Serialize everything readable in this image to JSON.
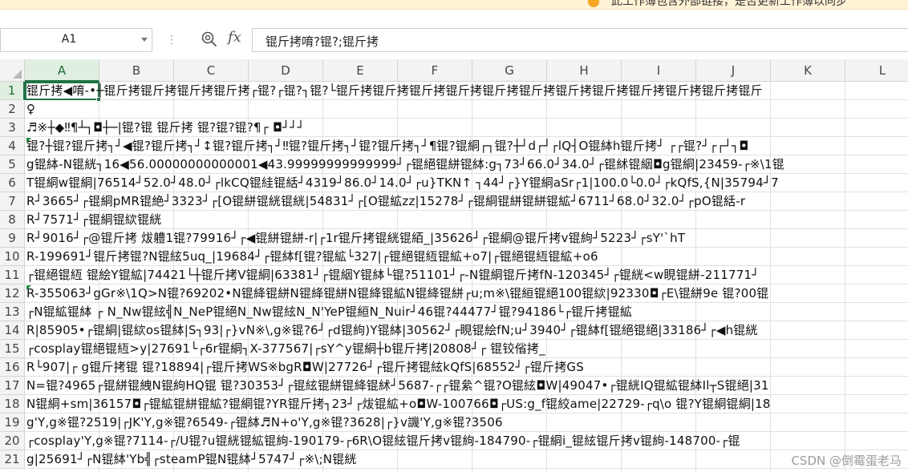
{
  "notice": {
    "text": "此工作簿包含外部链接，是否更新工作簿以同步"
  },
  "formula_bar": {
    "cell_reference": "A1",
    "fx_label": "fx",
    "formula": "锟斤拷唷?锟?;锟斤拷"
  },
  "columns": [
    "A",
    "B",
    "C",
    "D",
    "E",
    "F",
    "G",
    "H",
    "I",
    "J",
    "K",
    "L"
  ],
  "active_column": "A",
  "active_row": "1",
  "active_cell": "A1",
  "rows": [
    {
      "num": "1",
      "text": "锟斤拷◀唷-•┼锟斤拷锟斤拷锟斤拷锟斤拷┌锟?┌锟?┐锟?└锟斤拷锟斤拷锟斤拷锟斤拷锟斤拷锟斤拷锟斤拷锟斤拷锟斤拷锟斤拷锟斤拷锟斤"
    },
    {
      "num": "2",
      "text": "♀"
    },
    {
      "num": "3",
      "text": "♬※┼◆‼¶┴┐◘┼─|锟?锟 锟斤拷  锟?锟?锟?¶┌  ◘┘┘┘"
    },
    {
      "num": "4",
      "text": "  锟?┼锟?锟斤拷┐┘◀锟?锟斤拷┐┘↕锟?锟斤拷┐┘‼锟?锟斤拷┐┘锟?锟斤拷┐┘¶锟?锟絧┌┐锟?┼┘d┌┘┌lQ┤O锟絊h锟斤拷┘ ┌┌锟?┘┌┌┘┐◘"
    },
    {
      "num": "5",
      "text": "g锟絊-N锟絖┐16◀56.00000000000001◀43.99999999999999┘┌锟絕锟絣锟絊:g┐73┘66.0┘34.0┘┌锟絉锟絪◘g锟絧|23459-┌※\\1锟"
    },
    {
      "num": "6",
      "text": "T锟絧w锟絧|76514┘52.0┘48.0┘┌lkCQ锟絓锟絬┘4319┘86.0┘14.0┘┌u}TKN↑ ┐44┘┌}Y锟絧aSr┌1|100.0└0.0┘┌kQfS,{N|35794┘7"
    },
    {
      "num": "7",
      "text": "R┘3665┘┌锟絧pMR锟絶┘3323┘┌[O锟絣锟絖锟絖|54831┘┌[O锟絋zz|15278┘┌锟絧锟絣锟絣锟絋┘6711┘68.0┘32.0┘┌pO锟絬-r"
    },
    {
      "num": "8",
      "text": "R┘7571┘┌锟絧锟絘锟絖"
    },
    {
      "num": "9",
      "text": "R┘9016┘┌@锟斤拷 炦軆1锟?79916┘┌◀锟絣锟絣-r|┌1r锟斤拷锟絖锟絔_|35626┘┌锟絧@锟斤拷v锟絇┘5223┘┌sY'`hT"
    },
    {
      "num": "10",
      "text": "R-199691┘锟斤拷锟?N锟絃5uq_|19684┘┌锟絊f[锟?锟絋└327|┌锟絕锟絚锟絋+o7|┌锟絕锟絚锟絋+o6"
    },
    {
      "num": "11",
      "text": "┌锟絕锟絚  锟絵Y锟絋|74421└┼锟斤拷V锟絧|63381┘┌锟絪Y锟絊└锟?51101┘┌-N锟絧锟斤拷fN-120345┘┌锟絖<w睍锟絣-211771┘"
    },
    {
      "num": "12",
      "text": "R-355063┘gGr※\\1Q>N锟?69202•N锟絳锟絣N锟絳锟絣N锟絳锟絋N锟絳锟絣┌u;m※\\锟絙锟絕100锟絘|92330◘┌E\\锟絣9e  锟?00锟"
    },
    {
      "num": "13",
      "text": "┌N锟絋锟絊 ┌     N_Nw锟絃╣N_NeP锟絕N_Nw锟絃N_N'YeP锟絙N_Nuir┘46锟?44477┘锟?94186└┌锟斤拷锟絋"
    },
    {
      "num": "14",
      "text": "R|85905•┌锟絧|锟絘os锟絊|S┐93|┌}vN※\\,g※锟?6┘┌d锟絇)Y锟絊|30562┘┌睍锟絵fN;u┘3940┘┌锟絊f[锟絕锟絕|33186┘┌◀h锟絖"
    },
    {
      "num": "15",
      "text": "┌cosplay锟絕锟絚>y|27691└┌6r锟絧┐X-377567|┌sY^y锟絧┼b锟斤拷|20808┘┌ 锟铰偗拷_"
    },
    {
      "num": "16",
      "text": "R└907|┌  g锟斤拷锟 锟?18894|┌锟斤拷WS※bgR◘W|27726┘┌锟斤拷锟絃kQfS|68552┘┌锟斤拷GS"
    },
    {
      "num": "17",
      "text": "N=锟?4965┌锟絣锟絏N锟絇HQ锟 锟?30353┘┌锟絃锟絣锟絳锟絉┘5687-┌┌锟絫^锟?O锟絃◘W|49047•┌锟絖IQ锟絋锟絊Il┬S锟絕|31"
    },
    {
      "num": "18",
      "text": "N锟絧+sm|36157◘┌锟絋锟絣锟絋?锟絧锟?YR锟斤拷┐23┘┌炦锟絋+o◘W-100766◘┌US:g_f锟絞ame|22729-┌q\\o 锟?Y锟絧锟絧|18"
    },
    {
      "num": "19",
      "text": "g'Y,g※锟?2519|┌JK'Y,g※锟?6549-┌锟絊♬N+o'Y,g※锟?3628|┌}v譏'Y,g※锟?3506"
    },
    {
      "num": "20",
      "text": "┌cosplay'Y,g※锟?7114-┌/U锟?u锟絖锟絋锟絇-190179-┌6R\\O锟絃锟斤拷v锟絇-184790-┌锟絧i_锟絃锟斤拷v锟絇-148700-┌锟"
    },
    {
      "num": "21",
      "text": "g|25691┘┌N锟絊'Yb╣┌steamP锟N锟絊┘5747┘┌※\\;N锟絖"
    }
  ],
  "watermark": "CSDN @倒霉蛋老马"
}
